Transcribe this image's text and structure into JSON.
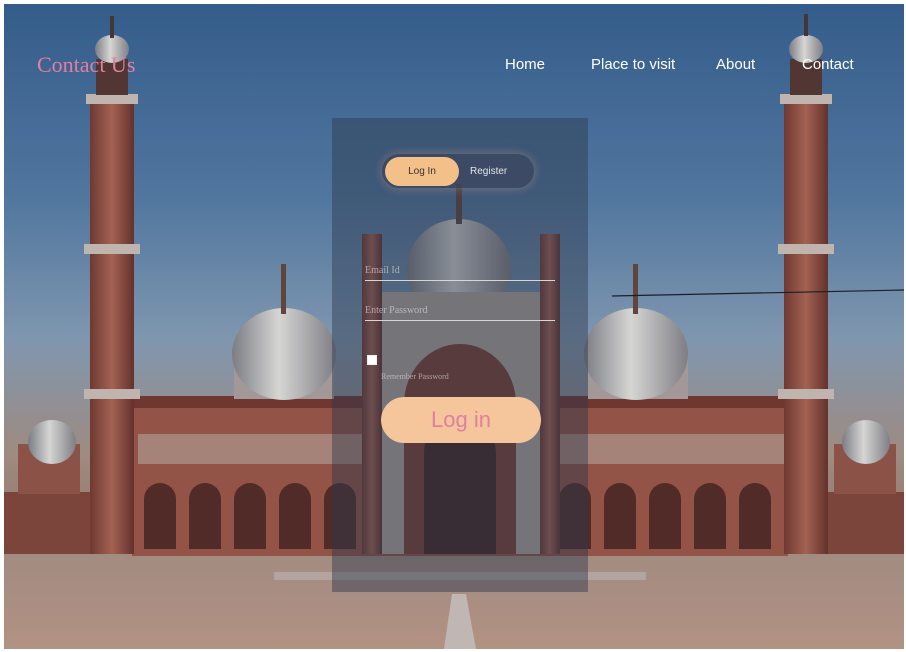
{
  "header": {
    "brand": "Contact Us",
    "nav": [
      "Home",
      "Place to visit",
      "About",
      "Contact"
    ]
  },
  "login": {
    "tabs": [
      "Log In",
      "Register"
    ],
    "active_tab": "Log In",
    "email_placeholder": "Email Id",
    "password_placeholder": "Enter Password",
    "remember_label": "Remember Password",
    "submit_label": "Log in"
  },
  "colors": {
    "brand": "#e07fa0",
    "accent": "#f4c089",
    "panel": "#2d374b"
  }
}
